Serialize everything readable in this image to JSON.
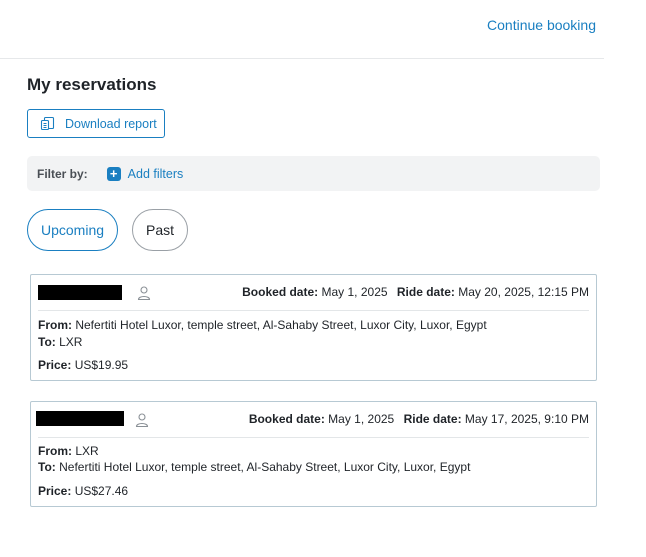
{
  "header": {
    "continue_label": "Continue booking"
  },
  "page": {
    "title": "My reservations"
  },
  "download": {
    "label": "Download report"
  },
  "filter": {
    "label": "Filter by:",
    "add_label": "Add filters"
  },
  "tabs": {
    "upcoming": "Upcoming",
    "past": "Past",
    "active": "upcoming"
  },
  "labels": {
    "booked_date": "Booked date:",
    "ride_date": "Ride date:",
    "from": "From:",
    "to": "To:",
    "price": "Price:"
  },
  "reservations": [
    {
      "booked_date": "May 1, 2025",
      "ride_date": "May 20, 2025, 12:15 PM",
      "from": "Nefertiti Hotel Luxor, temple street, Al-Sahaby Street, Luxor City, Luxor, Egypt",
      "to": "LXR",
      "price": "US$19.95"
    },
    {
      "booked_date": "May 1, 2025",
      "ride_date": "May 17, 2025, 9:10 PM",
      "from": "LXR",
      "to": "Nefertiti Hotel Luxor, temple street, Al-Sahaby Street, Luxor City, Luxor, Egypt",
      "price": "US$27.46"
    }
  ],
  "colors": {
    "accent": "#1a7fc1",
    "card_border": "#b7c9d3",
    "filter_bg": "#f2f3f4"
  },
  "icons": {
    "download": "document-download-icon",
    "add": "plus-icon",
    "passenger": "user-icon"
  }
}
